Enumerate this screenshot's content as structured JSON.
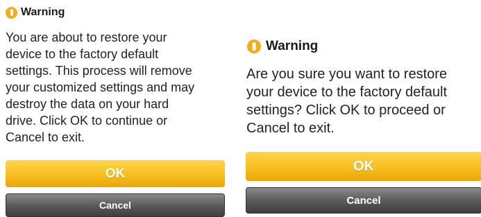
{
  "colors": {
    "warning_icon": "#f2ae16",
    "ok_button": "#f7be1f",
    "cancel_button": "#5c5c5c",
    "text": "#222222"
  },
  "dialog_left": {
    "title": "Warning",
    "icon": "warning-icon",
    "message": "You are about to restore your\ndevice to the factory default\nsettings. This process will remove\nyour customized settings and may\ndestroy the data on your hard\ndrive. Click OK to continue or\nCancel to exit.",
    "ok_label": "OK",
    "cancel_label": "Cancel"
  },
  "dialog_right": {
    "title": "Warning",
    "icon": "warning-icon",
    "message": "Are you sure you want to restore\nyour device to the factory default\nsettings? Click OK to proceed or\nCancel to exit.",
    "ok_label": "OK",
    "cancel_label": "Cancel"
  }
}
